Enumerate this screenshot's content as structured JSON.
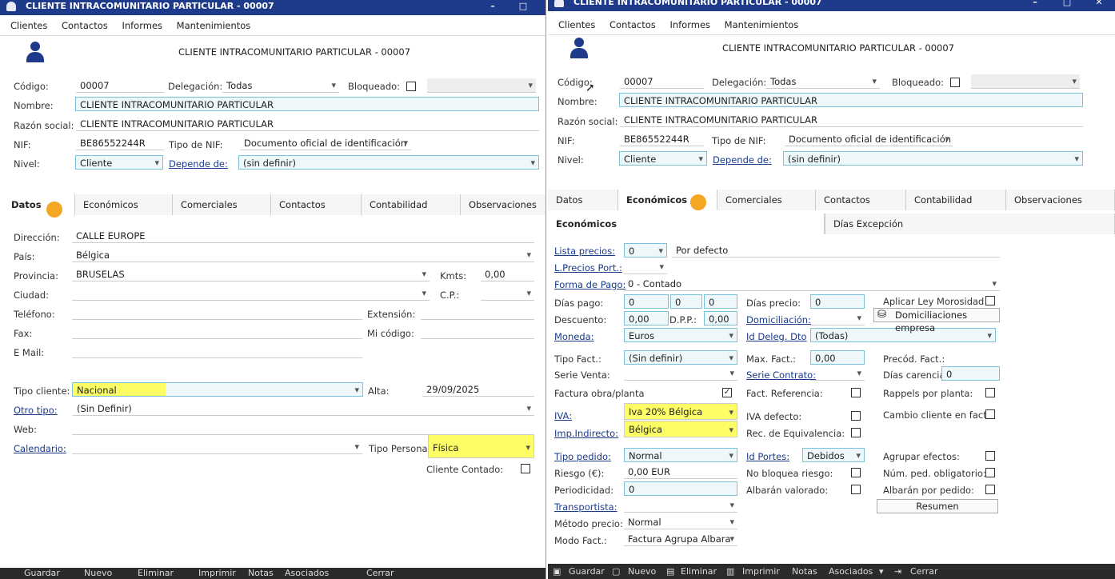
{
  "left": {
    "title": "CLIENTE INTRACOMUNITARIO PARTICULAR - 00007",
    "menu": [
      "Clientes",
      "Contactos",
      "Informes",
      "Mantenimientos"
    ],
    "header": "CLIENTE INTRACOMUNITARIO PARTICULAR - 00007",
    "codigo_label": "Código:",
    "codigo": "00007",
    "delegacion_label": "Delegación:",
    "delegacion": "Todas",
    "bloqueado_label": "Bloqueado:",
    "nombre_label": "Nombre:",
    "nombre": "CLIENTE INTRACOMUNITARIO PARTICULAR",
    "razon_label": "Razón social:",
    "razon": "CLIENTE INTRACOMUNITARIO PARTICULAR",
    "nif_label": "NIF:",
    "nif": "BE86552244R",
    "tiponif_label": "Tipo de NIF:",
    "tiponif": "Documento oficial de identificación",
    "nivel_label": "Nivel:",
    "nivel": "Cliente",
    "depende_label": "Depende de:",
    "depende": "(sin definir)",
    "tabs": [
      "Datos",
      "Económicos",
      "Comerciales",
      "Contactos",
      "Contabilidad",
      "Observaciones"
    ],
    "direccion_label": "Dirección:",
    "direccion": "CALLE EUROPE",
    "pais_label": "País:",
    "pais": "Bélgica",
    "provincia_label": "Provincia:",
    "provincia": "BRUSELAS",
    "kmts_label": "Kmts:",
    "kmts": "0,00",
    "ciudad_label": "Ciudad:",
    "cp_label": "C.P.:",
    "telefono_label": "Teléfono:",
    "extension_label": "Extensión:",
    "fax_label": "Fax:",
    "micodigo_label": "Mi código:",
    "email_label": "E Mail:",
    "tipocliente_label": "Tipo cliente:",
    "tipocliente": "Nacional",
    "alta_label": "Alta:",
    "alta": "29/09/2025",
    "otrotipo_label": "Otro tipo:",
    "otrotipo": "(Sin Definir)",
    "web_label": "Web:",
    "calendario_label": "Calendario:",
    "tipopersona_label": "Tipo Persona:",
    "tipopersona": "Física",
    "contado_label": "Cliente Contado:",
    "bottom": [
      "Guardar",
      "Nuevo",
      "Eliminar",
      "Imprimir",
      "Notas",
      "Asociados",
      "Cerrar"
    ]
  },
  "right": {
    "title": "CLIENTE INTRACOMUNITARIO PARTICULAR - 00007",
    "menu": [
      "Clientes",
      "Contactos",
      "Informes",
      "Mantenimientos"
    ],
    "header": "CLIENTE INTRACOMUNITARIO PARTICULAR - 00007",
    "codigo_label": "Código:",
    "codigo": "00007",
    "delegacion_label": "Delegación:",
    "delegacion": "Todas",
    "bloqueado_label": "Bloqueado:",
    "nombre_label": "Nombre:",
    "nombre": "CLIENTE INTRACOMUNITARIO PARTICULAR",
    "razon_label": "Razón social:",
    "razon": "CLIENTE INTRACOMUNITARIO PARTICULAR",
    "nif_label": "NIF:",
    "nif": "BE86552244R",
    "tiponif_label": "Tipo de NIF:",
    "tiponif": "Documento oficial de identificación",
    "nivel_label": "Nivel:",
    "nivel": "Cliente",
    "depende_label": "Depende de:",
    "depende": "(sin definir)",
    "tabs": [
      "Datos",
      "Económicos",
      "Comerciales",
      "Contactos",
      "Contabilidad",
      "Observaciones"
    ],
    "subtabs": [
      "Económicos",
      "Días Excepción"
    ],
    "lista_label": "Lista precios:",
    "lista": "0",
    "lista_desc": "Por defecto",
    "lprecios_label": "L.Precios Port.:",
    "forma_label": "Forma de Pago:",
    "forma": "0 - Contado",
    "diaspago_label": "Días pago:",
    "dp1": "0",
    "dp2": "0",
    "dp3": "0",
    "diasprecio_label": "Días precio:",
    "diasprecio": "0",
    "aplicar_label": "Aplicar Ley Morosidad",
    "descuento_label": "Descuento:",
    "descuento": "0,00",
    "dpp_label": "D.P.P.:",
    "dpp": "0,00",
    "domiciliacion_label": "Domiciliación:",
    "domicil_btn": "Domiciliaciones empresa",
    "moneda_label": "Moneda:",
    "moneda": "Euros",
    "iddeleg_label": "Id Deleg. Dto",
    "iddeleg": "(Todas)",
    "tipofact_label": "Tipo Fact.:",
    "tipofact": "(Sin definir)",
    "maxfact_label": "Max. Fact.:",
    "maxfact": "0,00",
    "precod_label": "Precód. Fact.:",
    "serieventa_label": "Serie Venta:",
    "seriecontrato_label": "Serie Contrato:",
    "diascarencia_label": "Días carencia:",
    "diascarencia": "0",
    "factobra_label": "Factura obra/planta",
    "factref_label": "Fact. Referencia:",
    "rappels_label": "Rappels por planta:",
    "iva_label": "IVA:",
    "iva": "Iva 20% Bélgica",
    "ivadefecto_label": "IVA defecto:",
    "cambio_label": "Cambio cliente en fact.:",
    "impind_label": "Imp.Indirecto:",
    "impind": "Bélgica",
    "receq_label": "Rec. de Equivalencia:",
    "tipoped_label": "Tipo pedido:",
    "tipoped": "Normal",
    "idportes_label": "Id Portes:",
    "idportes": "Debidos",
    "agrupar_label": "Agrupar efectos:",
    "riesgo_label": "Riesgo (€):",
    "riesgo": "0,00 EUR",
    "nobloquea_label": "No bloquea riesgo:",
    "numped_label": "Núm. ped. obligatorio:",
    "periodicidad_label": "Periodicidad:",
    "periodicidad": "0",
    "albaran_label": "Albarán valorado:",
    "albaranped_label": "Albarán por pedido:",
    "resumen": "Resumen",
    "transportista_label": "Transportista:",
    "metodo_label": "Método precio:",
    "metodo": "Normal",
    "modo_label": "Modo Fact.:",
    "modo": "Factura Agrupa Albara",
    "bottom": [
      "Guardar",
      "Nuevo",
      "Eliminar",
      "Imprimir",
      "Notas",
      "Asociados",
      "Cerrar"
    ]
  }
}
